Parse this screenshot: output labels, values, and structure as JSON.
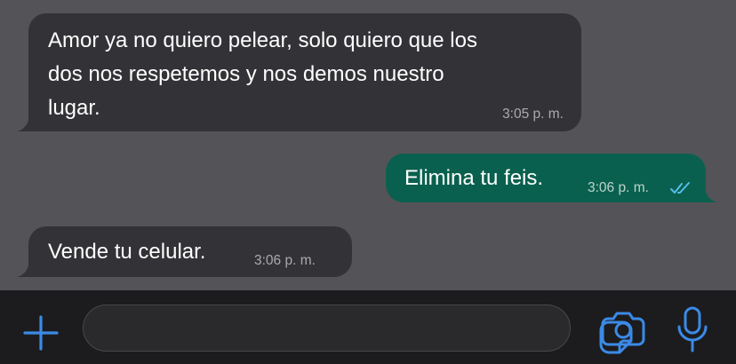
{
  "colors": {
    "chat_background": "#545358",
    "incoming_bubble": "#333337",
    "outgoing_bubble": "#0a604e",
    "input_bar": "#1c1c1e",
    "accent_icon": "#3b8ae6",
    "read_ticks": "#53bdeb"
  },
  "messages": [
    {
      "direction": "incoming",
      "text": "Amor ya no quiero pelear, solo quiero que los\ndos nos respetemos y nos demos nuestro\nlugar.",
      "time": "3:05 p. m."
    },
    {
      "direction": "outgoing",
      "text": "Elimina tu feis.",
      "time": "3:06 p. m.",
      "status": "read",
      "status_icon": "double-check-icon"
    },
    {
      "direction": "incoming",
      "text": "Vende tu celular.",
      "time": "3:06 p. m."
    }
  ],
  "input_bar": {
    "left_icon": "plus-icon",
    "message_value": "",
    "inline_icon": "sticker-icon",
    "right_icons": [
      "camera-icon",
      "microphone-icon"
    ]
  }
}
